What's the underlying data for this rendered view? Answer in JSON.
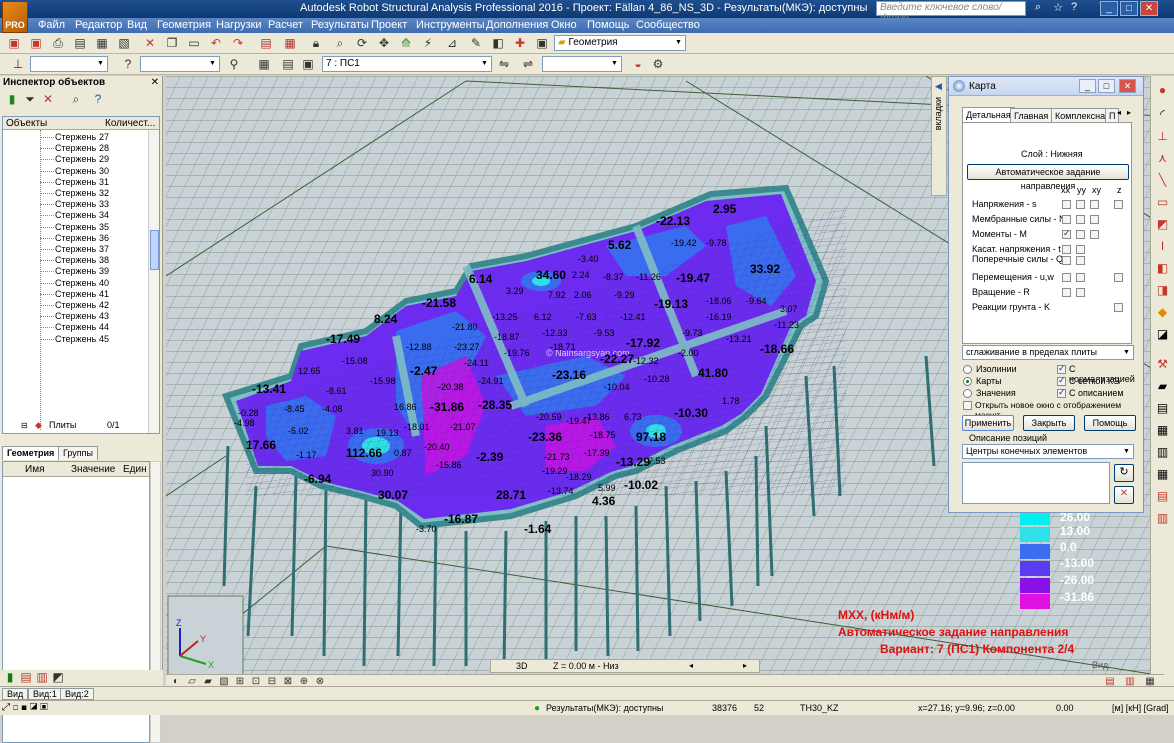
{
  "app": {
    "title": "Autodesk Robot Structural Analysis Professional 2016 - Проект: Fällan 4_86_NS_3D - Результаты(МКЭ): доступны",
    "logo_text": "PRO",
    "search_placeholder": "Введите ключевое слово/фразу"
  },
  "menu": [
    "Файл",
    "Редактор",
    "Вид",
    "Геометрия",
    "Нагрузки",
    "Расчет",
    "Результаты",
    "Проект",
    "Инструменты",
    "Дополнения",
    "Окно",
    "Помощь",
    "Сообщество"
  ],
  "toolbar": {
    "layout_combo": "Геометрия",
    "case_combo": "7 : ПС1"
  },
  "inspector": {
    "title": "Инспектор объектов",
    "col_objects": "Объекты",
    "col_count": "Количест...",
    "items": [
      {
        "label": "Стержень",
        "num": "27"
      },
      {
        "label": "Стержень",
        "num": "28"
      },
      {
        "label": "Стержень",
        "num": "29"
      },
      {
        "label": "Стержень",
        "num": "30"
      },
      {
        "label": "Стержень",
        "num": "31"
      },
      {
        "label": "Стержень",
        "num": "32"
      },
      {
        "label": "Стержень",
        "num": "33"
      },
      {
        "label": "Стержень",
        "num": "34"
      },
      {
        "label": "Стержень",
        "num": "35"
      },
      {
        "label": "Стержень",
        "num": "36"
      },
      {
        "label": "Стержень",
        "num": "37"
      },
      {
        "label": "Стержень",
        "num": "38"
      },
      {
        "label": "Стержень",
        "num": "39"
      },
      {
        "label": "Стержень",
        "num": "40"
      },
      {
        "label": "Стержень",
        "num": "41"
      },
      {
        "label": "Стержень",
        "num": "42"
      },
      {
        "label": "Стержень",
        "num": "43"
      },
      {
        "label": "Стержень",
        "num": "44"
      },
      {
        "label": "Стержень",
        "num": "45"
      }
    ],
    "plates_label": "Плиты",
    "plates_count": "0/1",
    "tab_geometry": "Геометрия",
    "tab_groups": "Группы",
    "props_col_name": "Имя",
    "props_col_value": "Значение",
    "props_col_unit": "Един"
  },
  "viewport": {
    "watermark": "© Nairisargsyan.com",
    "labels": [
      {
        "t": "-22.13"
      },
      {
        "t": "2.95"
      },
      {
        "t": "-19.42"
      },
      {
        "t": "-9.78"
      },
      {
        "t": "5.62"
      },
      {
        "t": "-3.40"
      },
      {
        "t": "6.14"
      },
      {
        "t": "34.60"
      },
      {
        "t": "2.24"
      },
      {
        "t": "-8.37"
      },
      {
        "t": "-11.26"
      },
      {
        "t": "-19.47"
      },
      {
        "t": "33.92"
      },
      {
        "t": "-21.58"
      },
      {
        "t": "3.29"
      },
      {
        "t": "7.92"
      },
      {
        "t": "2.06"
      },
      {
        "t": "-9.29"
      },
      {
        "t": "-19.13"
      },
      {
        "t": "-18.06"
      },
      {
        "t": "-9.64"
      },
      {
        "t": "3.07"
      },
      {
        "t": "8.24"
      },
      {
        "t": "-13.25"
      },
      {
        "t": "6.12"
      },
      {
        "t": "-7.63"
      },
      {
        "t": "-12.41"
      },
      {
        "t": "-16.19"
      },
      {
        "t": "-11.23"
      },
      {
        "t": "-17.49"
      },
      {
        "t": "-21.80"
      },
      {
        "t": "-18.87"
      },
      {
        "t": "-12.33"
      },
      {
        "t": "-9.53"
      },
      {
        "t": "-9.73"
      },
      {
        "t": "-13.21"
      },
      {
        "t": "-12.88"
      },
      {
        "t": "-23.27"
      },
      {
        "t": "-19.76"
      },
      {
        "t": "-18.71"
      },
      {
        "t": "-17.92"
      },
      {
        "t": "-18.66"
      },
      {
        "t": "12.65"
      },
      {
        "t": "-15.08"
      },
      {
        "t": "-24.11"
      },
      {
        "t": "-22.27"
      },
      {
        "t": "-12.32"
      },
      {
        "t": "-2.00"
      },
      {
        "t": "-15.98"
      },
      {
        "t": "-2.47"
      },
      {
        "t": "-24.91"
      },
      {
        "t": "-23.16"
      },
      {
        "t": "-10.28"
      },
      {
        "t": "41.80"
      },
      {
        "t": "-13.41"
      },
      {
        "t": "-8.61"
      },
      {
        "t": "-20.38"
      },
      {
        "t": "-10.04"
      },
      {
        "t": "1.78"
      },
      {
        "t": "-0.28"
      },
      {
        "t": "-8.45"
      },
      {
        "t": "-4.08"
      },
      {
        "t": "16.86"
      },
      {
        "t": "-31.86"
      },
      {
        "t": "-28.35"
      },
      {
        "t": "-19.47"
      },
      {
        "t": "-10.30"
      },
      {
        "t": "-4.98"
      },
      {
        "t": "-18.01"
      },
      {
        "t": "-20.59"
      },
      {
        "t": "-13.86"
      },
      {
        "t": "6.73"
      },
      {
        "t": "-5.02"
      },
      {
        "t": "3.81"
      },
      {
        "t": "19.13"
      },
      {
        "t": "-21.07"
      },
      {
        "t": "-23.36"
      },
      {
        "t": "-18.75"
      },
      {
        "t": "97.18"
      },
      {
        "t": "17.66"
      },
      {
        "t": "-20.40"
      },
      {
        "t": "-17.39"
      },
      {
        "t": "-1.17"
      },
      {
        "t": "112.66"
      },
      {
        "t": "0.87"
      },
      {
        "t": "-2.39"
      },
      {
        "t": "-21.73"
      },
      {
        "t": "-13.29"
      },
      {
        "t": "7.53"
      },
      {
        "t": "-15.86"
      },
      {
        "t": "-6.94"
      },
      {
        "t": "30.90"
      },
      {
        "t": "-19.29"
      },
      {
        "t": "-18.29"
      },
      {
        "t": "30.07"
      },
      {
        "t": "-13.74"
      },
      {
        "t": "5.99"
      },
      {
        "t": "-10.02"
      },
      {
        "t": "28.71"
      },
      {
        "t": "4.36"
      },
      {
        "t": "-16.87"
      },
      {
        "t": "-3.70"
      },
      {
        "t": "-1.64"
      }
    ]
  },
  "legend": {
    "values": [
      "26.00",
      "13.00",
      "0.0",
      "-13.00",
      "-26.00",
      "-31.86"
    ],
    "colors": [
      "#00f0f0",
      "#30e0e8",
      "#3c6cf0",
      "#5a3cf0",
      "#8a10e8",
      "#e010e0"
    ]
  },
  "caption": {
    "line1": "MXX, (кНм/м)",
    "line2": "Автоматическое задание направления",
    "line3": "Вариант:  7 (ПС1) Компонента 2/4"
  },
  "dialog": {
    "side_tab": "вкладки",
    "title": "Карта",
    "tabs": [
      "Детальная",
      "Главная",
      "Комплексная",
      "П"
    ],
    "layer": "Слой : Нижняя",
    "auto_dir_btn": "Автоматическое задание направления",
    "cols": [
      "xx",
      "yy",
      "xy",
      "z"
    ],
    "rows": [
      {
        "label": "Напряжения - s"
      },
      {
        "label": "Мембранные силы - N"
      },
      {
        "label": "Моменты - M"
      },
      {
        "label": "Касат. напряжения - t"
      },
      {
        "label": "Поперечные силы - Q"
      },
      {
        "label": "Перемещения - u,w"
      },
      {
        "label": "Вращение - R"
      },
      {
        "label": "Реакции грунта - K"
      }
    ],
    "smoothing": "сглаживание в пределах плиты",
    "opt_isolines": "Изолинии",
    "opt_maps": "Карты",
    "opt_values": "Значения",
    "opt_normalize": "С нормализацией",
    "opt_fe_grid": "С сеткой КЭ",
    "opt_description": "С описанием",
    "opt_new_window": "Открыть новое окно с отображением масшт",
    "btn_apply": "Применить",
    "btn_close": "Закрыть",
    "btn_help": "Помощь",
    "pos_desc_label": "Описание позиций",
    "pos_desc_value": "Центры конечных элементов"
  },
  "viewbar": {
    "mode": "3D",
    "level": "Z = 0.00 м - Низ"
  },
  "bottom_tabs": [
    "Вид",
    "Вид:1",
    "Вид:2"
  ],
  "vid_label": "Вид",
  "status": {
    "results": "Результаты(МКЭ): доступны",
    "n1": "38376",
    "n2": "52",
    "section": "TH30_KZ",
    "coords": "x=27.16; y=9.96; z=0.00",
    "angle": "0.00",
    "units": "[м] [кН] [Grad]"
  }
}
